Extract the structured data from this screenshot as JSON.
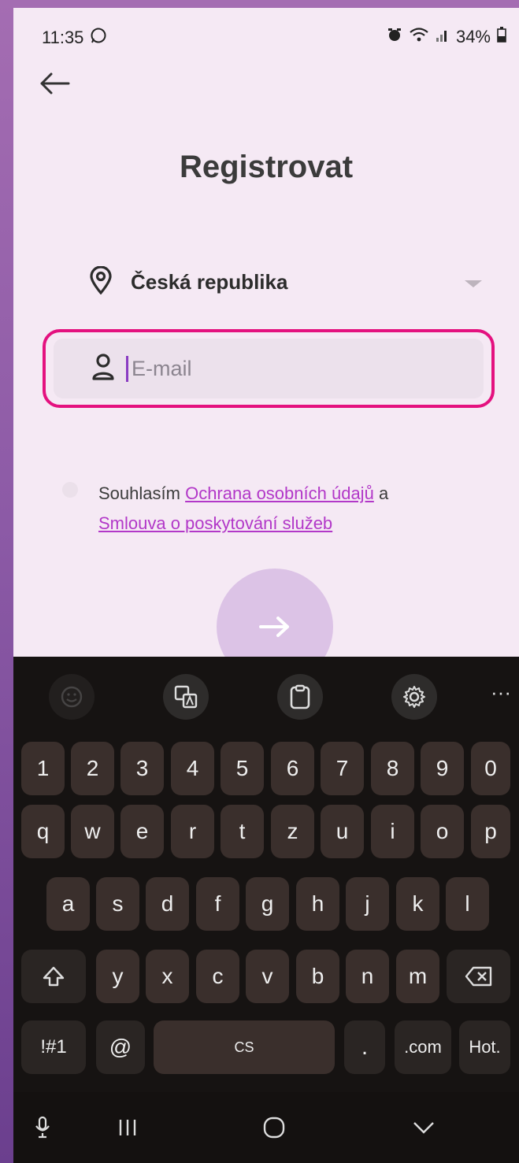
{
  "status_bar": {
    "time": "11:35",
    "battery": "34%"
  },
  "header": {
    "back_icon": "arrow-left-icon",
    "title": "Registrovat"
  },
  "form": {
    "country": "Česká republika",
    "email_placeholder": "E-mail",
    "email_value": ""
  },
  "consent": {
    "prefix": "Souhlasím",
    "privacy_link": "Ochrana osobních údajů",
    "conjunction": "a",
    "terms_link": "Smlouva o poskytování služeb"
  },
  "next_button": {
    "icon": "arrow-right-icon"
  },
  "keyboard": {
    "toolbar": [
      "emoji-icon",
      "translate-icon",
      "clipboard-icon",
      "gear-icon",
      "more-icon"
    ],
    "more_label": "···",
    "number_row": [
      "1",
      "2",
      "3",
      "4",
      "5",
      "6",
      "7",
      "8",
      "9",
      "0"
    ],
    "row1": [
      "q",
      "w",
      "e",
      "r",
      "t",
      "z",
      "u",
      "i",
      "o",
      "p"
    ],
    "row2": [
      "a",
      "s",
      "d",
      "f",
      "g",
      "h",
      "j",
      "k",
      "l"
    ],
    "row3": [
      "y",
      "x",
      "c",
      "v",
      "b",
      "n",
      "m"
    ],
    "symbols_label": "!#1",
    "at_label": "@",
    "space_label": "CS",
    "period_label": ".",
    "com_label": ".com",
    "hot_label": "Hot."
  },
  "colors": {
    "accent": "#e4117f",
    "link": "#b238c8",
    "background": "#f5e9f4"
  }
}
